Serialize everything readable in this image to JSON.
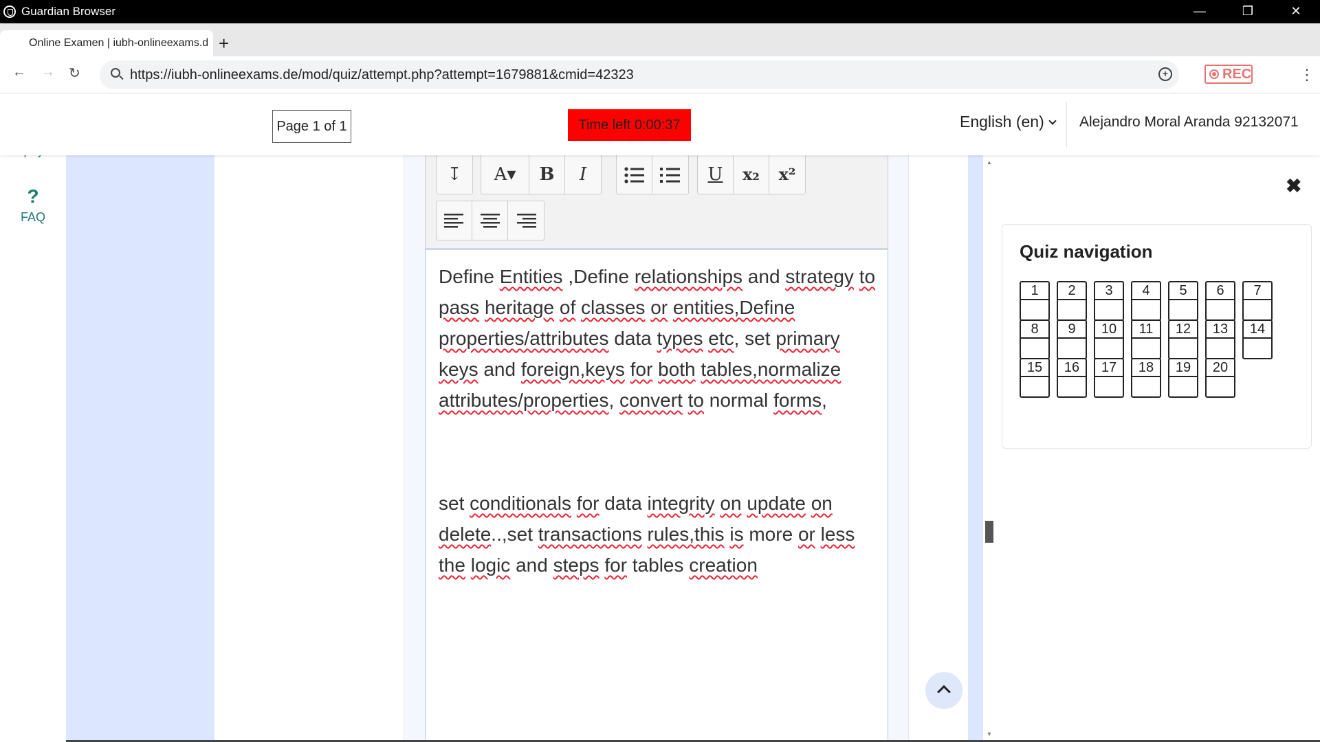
{
  "window": {
    "title": "Guardian Browser",
    "controls": {
      "minimize": "—",
      "restore": "❐",
      "close": "✕"
    }
  },
  "browser": {
    "tab_title": "Online Examen | iubh-onlineexams.d",
    "new_tab": "+",
    "url": "https://iubh-onlineexams.de/mod/quiz/attempt.php?attempt=1679881&cmid=42323",
    "rec_label": "REC",
    "nav": {
      "back": "←",
      "forward": "→",
      "reload": "↻",
      "menu": "⋮",
      "zoom": "+"
    }
  },
  "header": {
    "page_indicator": "Page 1 of 1",
    "timer": "Time left 0:00:37",
    "language": "English (en)",
    "user": "Alejandro Moral Aranda 92132071"
  },
  "sidebar": {
    "items": [
      {
        "label": "Apoyo",
        "icon": "chat-icon"
      },
      {
        "label": "FAQ",
        "icon": "question-icon",
        "glyph": "?"
      }
    ]
  },
  "editor": {
    "toolbar": {
      "expand": "↧",
      "font": "A▾",
      "bold": "B",
      "italic": "I",
      "underline": "U",
      "subscript": "x₂",
      "superscript": "x²"
    },
    "paragraph1": [
      [
        "Define ",
        false
      ],
      [
        "Entities",
        true
      ],
      [
        " ,Define ",
        false
      ],
      [
        "relationships",
        true
      ],
      [
        " and ",
        false
      ],
      [
        "strategy",
        true
      ],
      [
        " ",
        false
      ],
      [
        "to",
        true
      ],
      [
        " ",
        false
      ],
      [
        "pass",
        true
      ],
      [
        " ",
        false
      ],
      [
        "heritage",
        true
      ],
      [
        " ",
        false
      ],
      [
        "of",
        true
      ],
      [
        " ",
        false
      ],
      [
        "classes",
        true
      ],
      [
        " ",
        false
      ],
      [
        "or",
        true
      ],
      [
        " ",
        false
      ],
      [
        "entities,Define",
        true
      ],
      [
        " ",
        false
      ],
      [
        "properties/attributes",
        true
      ],
      [
        " ",
        false
      ],
      [
        "data ",
        false
      ],
      [
        "types",
        true
      ],
      [
        " ",
        false
      ],
      [
        "etc",
        true
      ],
      [
        ", set ",
        false
      ],
      [
        "primary",
        true
      ],
      [
        " ",
        false
      ],
      [
        "keys",
        true
      ],
      [
        " and ",
        false
      ],
      [
        "foreign,keys",
        true
      ],
      [
        " ",
        false
      ],
      [
        "for",
        true
      ],
      [
        " ",
        false
      ],
      [
        "both",
        true
      ],
      [
        " ",
        false
      ],
      [
        "tables,normalize",
        true
      ],
      [
        " ",
        false
      ],
      [
        "attributes/properties",
        true
      ],
      [
        ", ",
        false
      ],
      [
        "convert",
        true
      ],
      [
        " ",
        false
      ],
      [
        "to",
        true
      ],
      [
        " normal ",
        false
      ],
      [
        "forms",
        true
      ],
      [
        ",",
        false
      ]
    ],
    "paragraph2": [
      [
        "set ",
        false
      ],
      [
        "conditionals",
        true
      ],
      [
        " ",
        false
      ],
      [
        "for",
        true
      ],
      [
        " data ",
        false
      ],
      [
        "integrity",
        true
      ],
      [
        " ",
        false
      ],
      [
        "on",
        true
      ],
      [
        " ",
        false
      ],
      [
        "update",
        true
      ],
      [
        " ",
        false
      ],
      [
        "on",
        true
      ],
      [
        " ",
        false
      ],
      [
        "delete",
        true
      ],
      [
        "..,set ",
        false
      ],
      [
        "transactions",
        true
      ],
      [
        " ",
        false
      ],
      [
        "rules,this",
        true
      ],
      [
        " ",
        false
      ],
      [
        "is",
        true
      ],
      [
        " more ",
        false
      ],
      [
        "or",
        true
      ],
      [
        " ",
        false
      ],
      [
        "less",
        true
      ],
      [
        " ",
        false
      ],
      [
        "the",
        true
      ],
      [
        " ",
        false
      ],
      [
        "logic",
        true
      ],
      [
        " and ",
        false
      ],
      [
        "steps",
        true
      ],
      [
        " ",
        false
      ],
      [
        "for",
        true
      ],
      [
        " tables ",
        false
      ],
      [
        "creation",
        true
      ]
    ]
  },
  "quiz_navigation": {
    "title": "Quiz navigation",
    "close": "✖",
    "questions": [
      "1",
      "2",
      "3",
      "4",
      "5",
      "6",
      "7",
      "8",
      "9",
      "10",
      "11",
      "12",
      "13",
      "14",
      "15",
      "16",
      "17",
      "18",
      "19",
      "20"
    ]
  },
  "scroll_to_top_icon": "chevron-up-icon"
}
